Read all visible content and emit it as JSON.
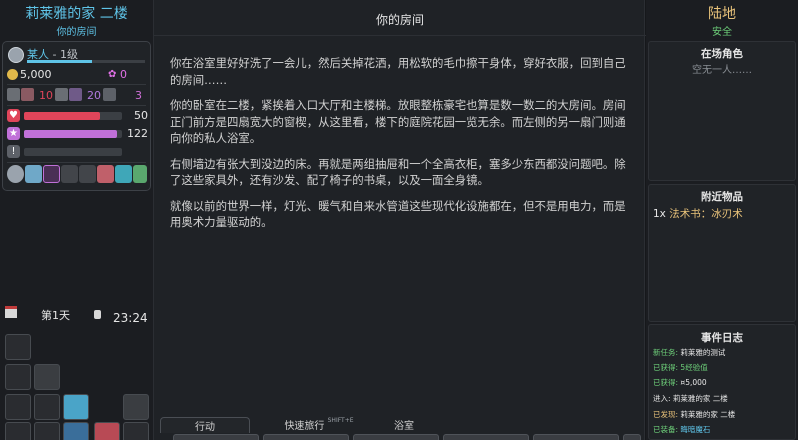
{
  "location": {
    "title": "莉莱雅的家 二楼",
    "subtitle": "你的房间"
  },
  "character": {
    "name": "某人",
    "level": "- 1级",
    "level_progress": 0.55,
    "money": "5,000",
    "gems": "0",
    "attributes": [
      "10",
      "20",
      "3"
    ],
    "health": {
      "value": "50",
      "fraction": 0.78,
      "color": "#e0455a"
    },
    "mana": {
      "value": "122",
      "fraction": 0.95,
      "color": "#c070d8"
    },
    "stamina": {
      "fraction": 0.0
    }
  },
  "status_icons": [
    "avatar-icon",
    "shield-icon",
    "gender-icon",
    "chain-icon",
    "feather-icon",
    "bolt-icon",
    "chevron-icon",
    "moon-icon"
  ],
  "clock": {
    "day": "第1天",
    "time": "23:24"
  },
  "room": {
    "title": "你的房间",
    "paragraphs": [
      "你在浴室里好好洗了一会儿，然后关掉花洒，用松软的毛巾擦干身体，穿好衣服，回到自己的房间……",
      "你的卧室在二楼，紧挨着入口大厅和主楼梯。放眼整栋豪宅也算是数一数二的大房间。房间正门前方是四扇宽大的窗楔，从这里看，楼下的庭院花园一览无余。而左侧的另一扇门则通向你的私人浴室。",
      "右侧墙边有张大到没边的床。再就是两组抽屉和一个全高衣柜，塞多少东西都没问题吧。除了这些家具外，还有沙发、配了椅子的书桌，以及一面全身镜。",
      "就像以前的世界一样，灯光、暖气和自来水管道这些现代化设施都在，但不是用电力，而是用奥术力量驱动的。"
    ]
  },
  "tabs": [
    {
      "label": "行动",
      "shortcut": ""
    },
    {
      "label": "快速旅行",
      "shortcut": "SHIFT+E"
    },
    {
      "label": "浴室",
      "shortcut": ""
    }
  ],
  "right": {
    "terrain": "陆地",
    "safety": "安全",
    "present_header": "在场角色",
    "present_none": "空无一人……",
    "nearby_header": "附近物品",
    "nearby_items": [
      {
        "qty": "1x",
        "name": "法术书：冰刃术"
      }
    ],
    "log_header": "事件日志",
    "log": [
      {
        "key": "新任务:",
        "detail": "莉莱雅的测试"
      },
      {
        "key": "已获得:",
        "detail": "5经验值"
      },
      {
        "key": "已获得:",
        "detail": "¤5,000"
      },
      {
        "key": "进入:",
        "detail": "莉莱雅的家 二楼"
      },
      {
        "key": "已发现:",
        "detail": "莉莱雅的家 二楼"
      },
      {
        "key": "已装备:",
        "detail": "晦暗魔石"
      }
    ]
  }
}
